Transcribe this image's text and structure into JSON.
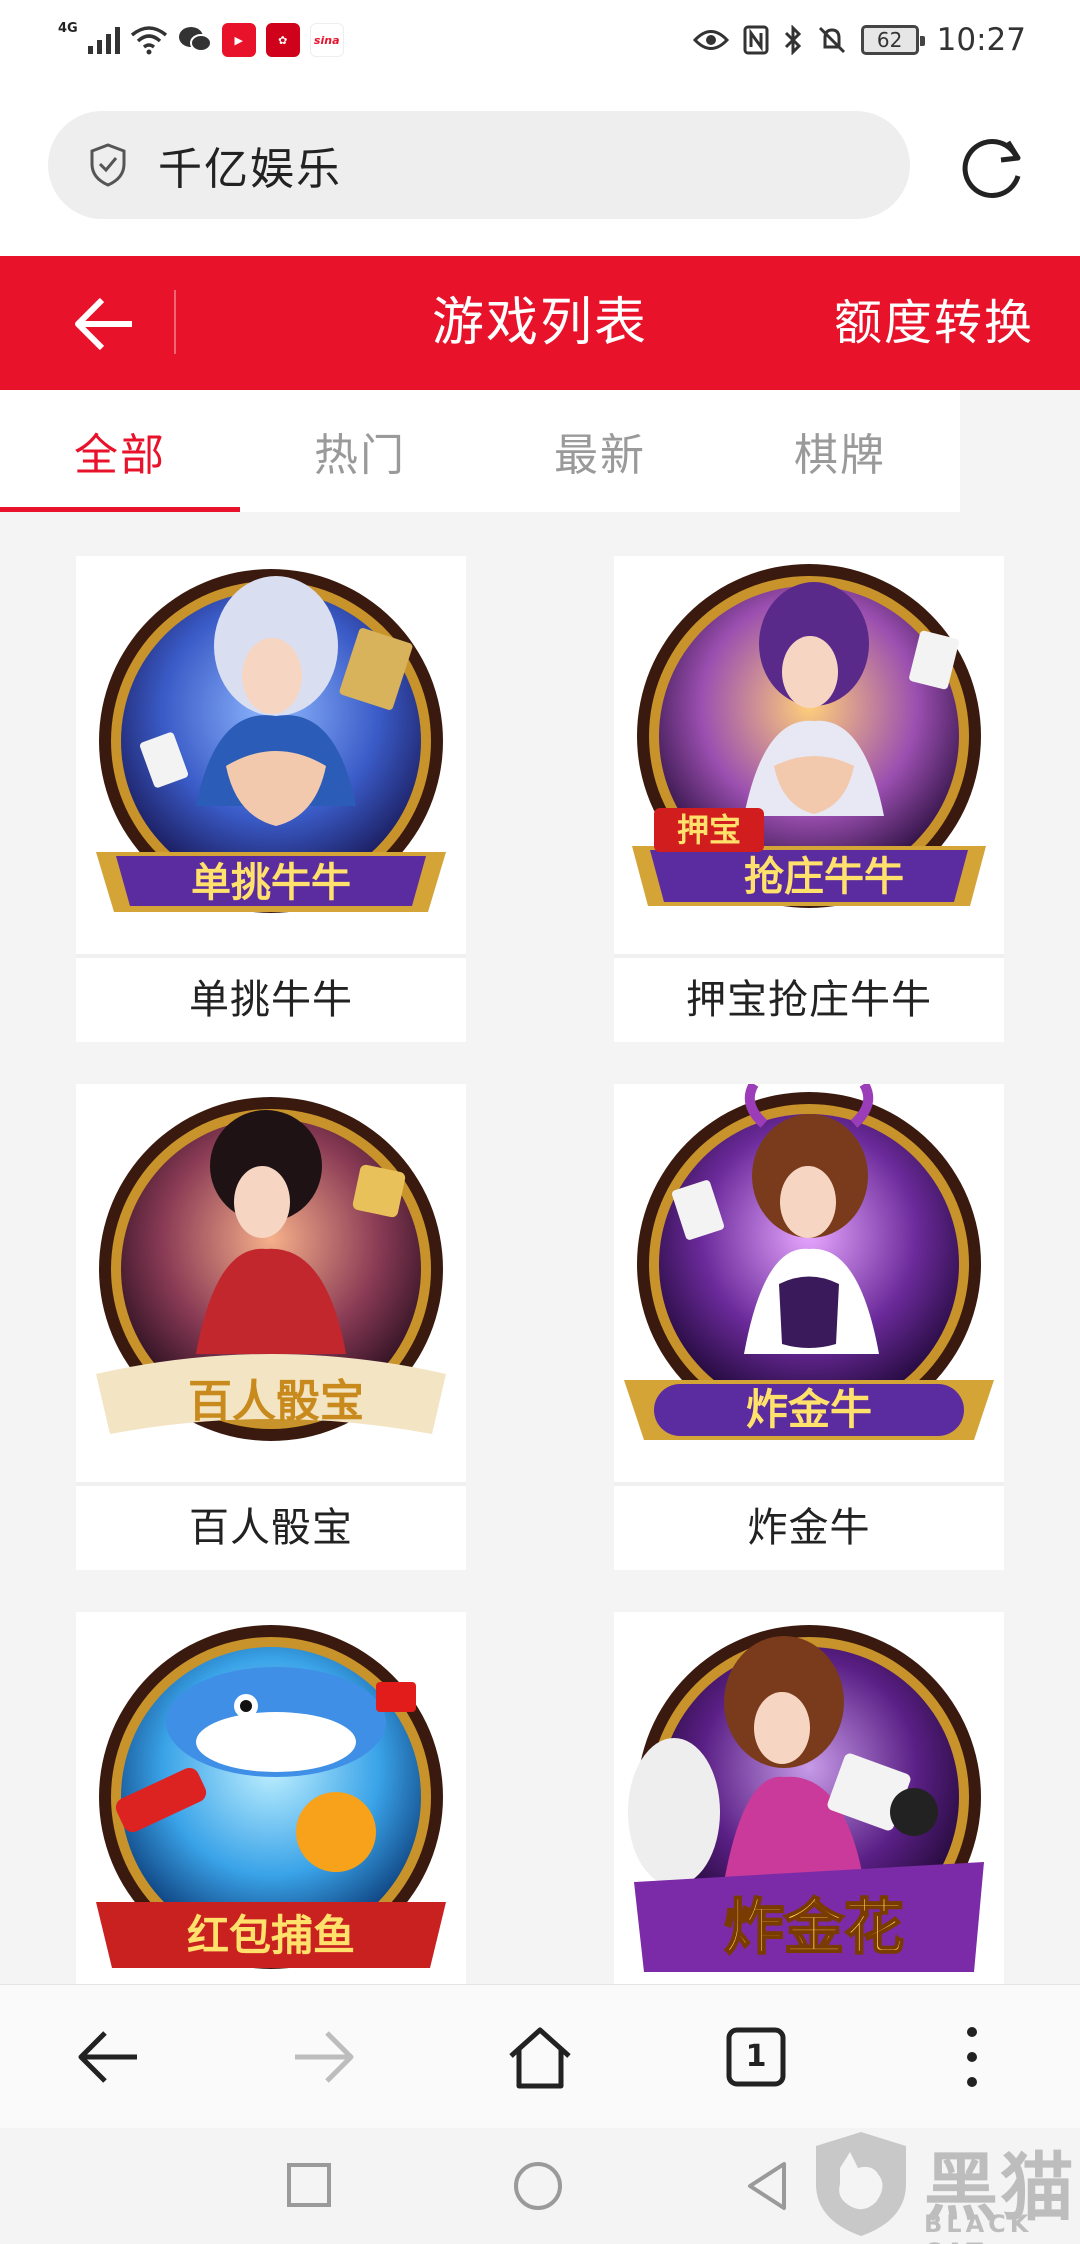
{
  "status_bar": {
    "network": "4G",
    "battery": "62",
    "time": "10:27"
  },
  "address_bar": {
    "url_text": "千亿娱乐"
  },
  "header": {
    "title": "游戏列表",
    "right_action": "额度转换"
  },
  "tabs": [
    {
      "label": "全部",
      "active": true
    },
    {
      "label": "热门",
      "active": false
    },
    {
      "label": "最新",
      "active": false
    },
    {
      "label": "棋牌",
      "active": false
    }
  ],
  "games": [
    {
      "name": "单挑牛牛",
      "banner": "单挑牛牛"
    },
    {
      "name": "押宝抢庄牛牛",
      "banner": "抢庄牛牛",
      "tag": "押宝"
    },
    {
      "name": "百人骰宝",
      "banner": "百人骰宝"
    },
    {
      "name": "炸金牛",
      "banner": "炸金牛"
    },
    {
      "name": "",
      "banner": "红包捕鱼"
    },
    {
      "name": "",
      "banner": "炸金花"
    }
  ],
  "bottom_bar": {
    "tab_count": "1"
  },
  "watermark": {
    "text": "黑猫",
    "sub": "BLACK CAT"
  },
  "colors": {
    "brand_red": "#e8132b",
    "background": "#f4f4f4"
  }
}
